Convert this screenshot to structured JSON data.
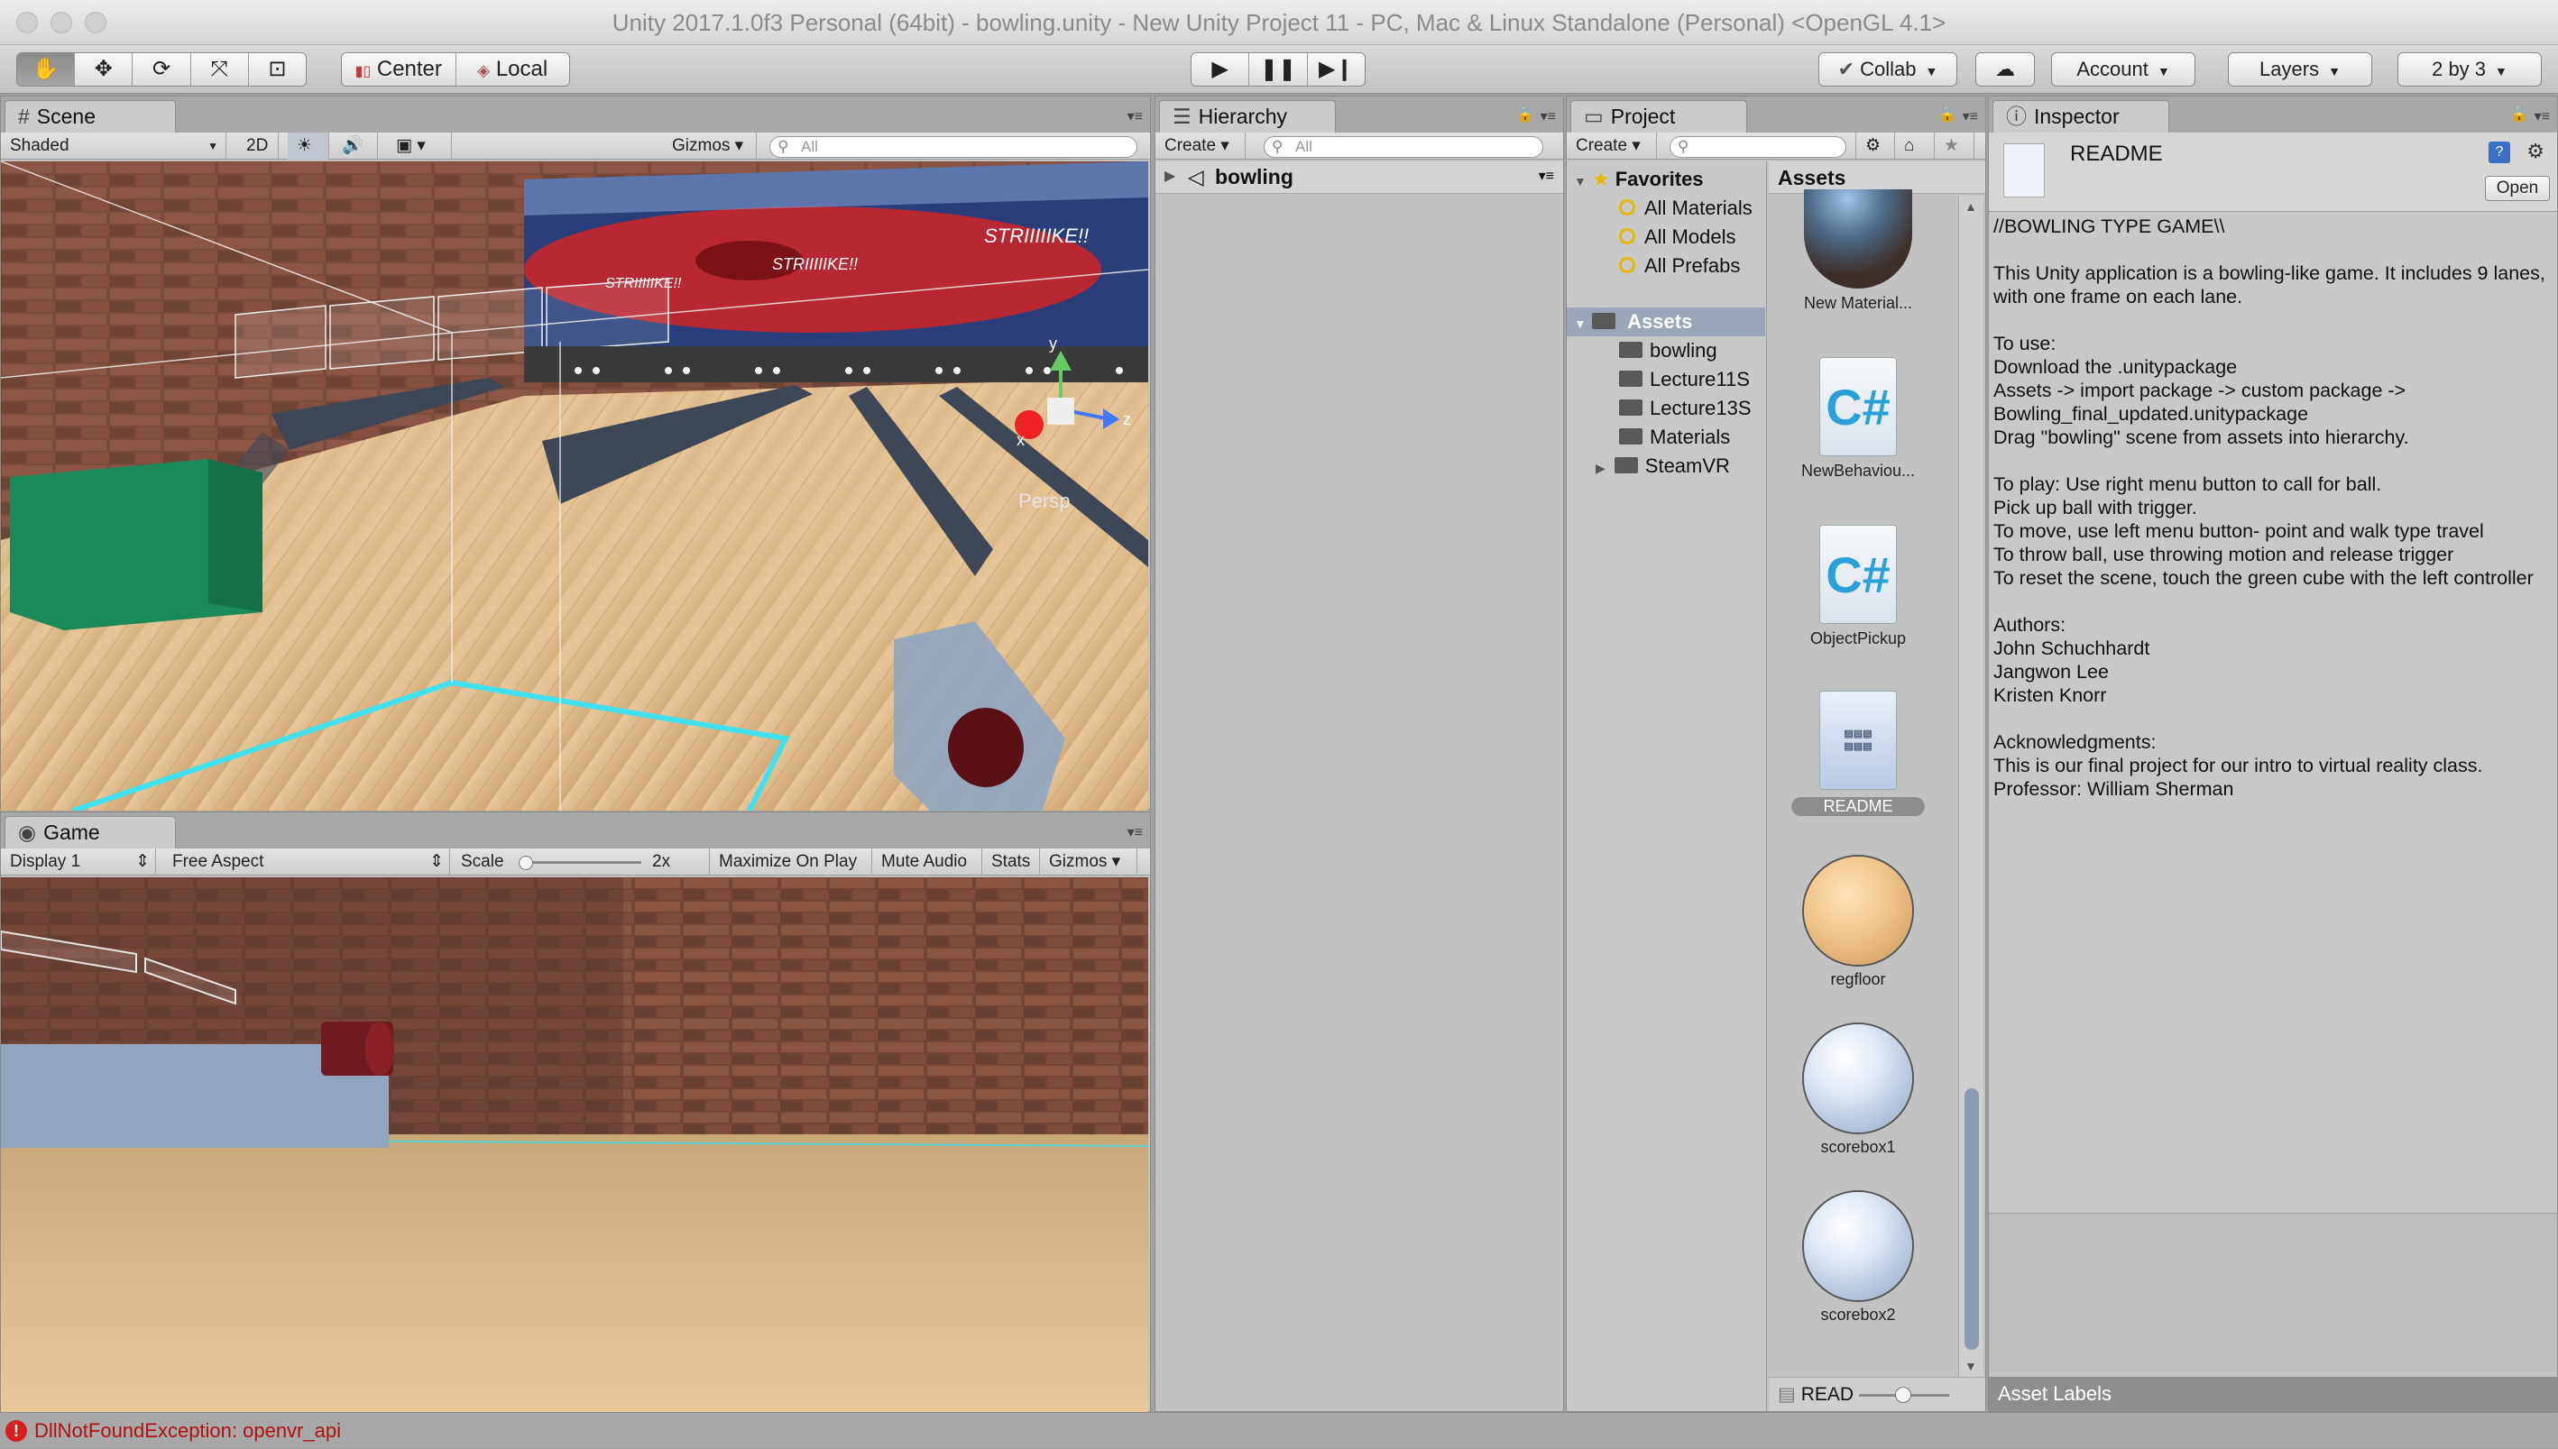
{
  "window": {
    "title": "Unity 2017.1.0f3 Personal (64bit) - bowling.unity - New Unity Project 11 - PC, Mac & Linux Standalone (Personal) <OpenGL 4.1>"
  },
  "toolbar": {
    "transform_tools": [
      "hand-tool-icon",
      "move-tool-icon",
      "rotate-tool-icon",
      "scale-tool-icon",
      "rect-tool-icon"
    ],
    "pivot_label": "Center",
    "space_label": "Local",
    "play_icons": [
      "play-icon",
      "pause-icon",
      "step-icon"
    ],
    "collab_label": "Collab",
    "account_label": "Account",
    "layers_label": "Layers",
    "layout_label": "2 by 3"
  },
  "scene": {
    "tab_label": "Scene",
    "shading_mode": "Shaded",
    "mode_2d": "2D",
    "gizmos_label": "Gizmos",
    "search_placeholder": "All",
    "persp_label": "Persp",
    "gizmo_axes": {
      "x": "x",
      "y": "y",
      "z": "z"
    },
    "banner_text": "STRIIIIIKE!!"
  },
  "game": {
    "tab_label": "Game",
    "display_label": "Display 1",
    "aspect_label": "Free Aspect",
    "scale_label": "Scale",
    "scale_value": "2x",
    "maximize_label": "Maximize On Play",
    "mute_label": "Mute Audio",
    "stats_label": "Stats",
    "gizmos_label": "Gizmos"
  },
  "hierarchy": {
    "tab_label": "Hierarchy",
    "create_label": "Create",
    "search_placeholder": "All",
    "scene_name": "bowling"
  },
  "project": {
    "tab_label": "Project",
    "create_label": "Create",
    "favorites_label": "Favorites",
    "favorites": [
      "All Materials",
      "All Models",
      "All Prefabs"
    ],
    "assets_label": "Assets",
    "folders": [
      "bowling",
      "Lecture11S",
      "Lecture13S",
      "Materials",
      "SteamVR"
    ],
    "grid_header": "Assets",
    "assets": [
      {
        "label": "New Material...",
        "type": "material-dark"
      },
      {
        "label": "NewBehaviou...",
        "type": "script"
      },
      {
        "label": "ObjectPickup",
        "type": "script"
      },
      {
        "label": "README",
        "type": "readme"
      },
      {
        "label": "regfloor",
        "type": "material-wood"
      },
      {
        "label": "scorebox1",
        "type": "material-white"
      },
      {
        "label": "scorebox2",
        "type": "material-white"
      }
    ],
    "footer_label": "READ"
  },
  "inspector": {
    "tab_label": "Inspector",
    "title": "README",
    "open_label": "Open",
    "body": "//BOWLING TYPE GAME\\\\\n\nThis Unity application is a bowling-like game. It includes 9 lanes, with one frame on each lane.\n\nTo use:\nDownload the .unitypackage\nAssets -> import package -> custom package ->\nBowling_final_updated.unitypackage\nDrag \"bowling\" scene from assets into hierarchy.\n\nTo play: Use right menu button to call for ball.\nPick up ball with trigger.\nTo move, use left menu button- point and walk type travel\nTo throw ball, use throwing motion and release trigger\nTo reset the scene, touch the green cube with the left controller\n\nAuthors:\nJohn Schuchhardt\nJangwon Lee\nKristen Knorr\n\nAcknowledgments:\nThis is our final project for our intro to virtual reality class.\nProfessor: William Sherman",
    "asset_labels": "Asset Labels"
  },
  "status": {
    "message": "DllNotFoundException: openvr_api"
  },
  "colors": {
    "accent_cyan": "#3fe0f0",
    "cube_green": "#1a8a5a",
    "error_red": "#d62020"
  }
}
